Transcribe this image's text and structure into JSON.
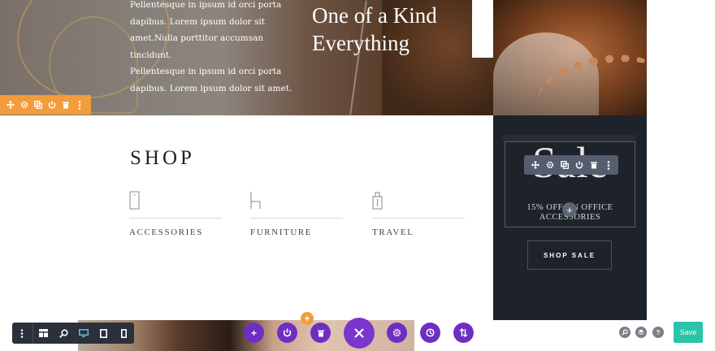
{
  "hero": {
    "body_text_lines": [
      "Pellentesque in ipsum id orci porta",
      "dapibus. Lorem ipsum dolor sit",
      "amet.Nulla porttitor accumsan tincidunt.",
      "Pellentesque in ipsum id orci porta",
      "dapibus. Lorem ipsum dolor sit amet."
    ],
    "title_line1": "One of a Kind",
    "title_line2": "Everything",
    "shop_button": "SHOP"
  },
  "module_toolbar": {
    "icons": [
      "move-icon",
      "settings-icon",
      "duplicate-icon",
      "power-icon",
      "trash-icon",
      "more-icon"
    ]
  },
  "shop": {
    "heading": "SHOP",
    "categories": [
      {
        "label": "ACCESSORIES",
        "icon": "phone-icon"
      },
      {
        "label": "FURNITURE",
        "icon": "chair-icon"
      },
      {
        "label": "TRAVEL",
        "icon": "luggage-icon"
      }
    ]
  },
  "sale": {
    "big_text": "Sale",
    "offer_line1": "15% OFF ON OFFICE",
    "offer_line2": "ACCESSORIES",
    "button": "SHOP SALE"
  },
  "builder_bar": {
    "left_icons": [
      "menu-icon",
      "layout-icon",
      "zoom-icon",
      "desktop-icon",
      "tablet-icon",
      "phone-icon"
    ],
    "center_icons": [
      "add-icon",
      "power-icon",
      "trash-icon",
      "close-icon",
      "settings-icon",
      "history-icon",
      "portability-icon"
    ],
    "right_icons": [
      "search-icon",
      "layers-icon",
      "help-icon"
    ],
    "save_label": "Save"
  },
  "colors": {
    "accent_orange": "#f39c3c",
    "builder_purple": "#6e2ec2",
    "save_green": "#29c4a9",
    "sale_bg": "#1e222a"
  }
}
